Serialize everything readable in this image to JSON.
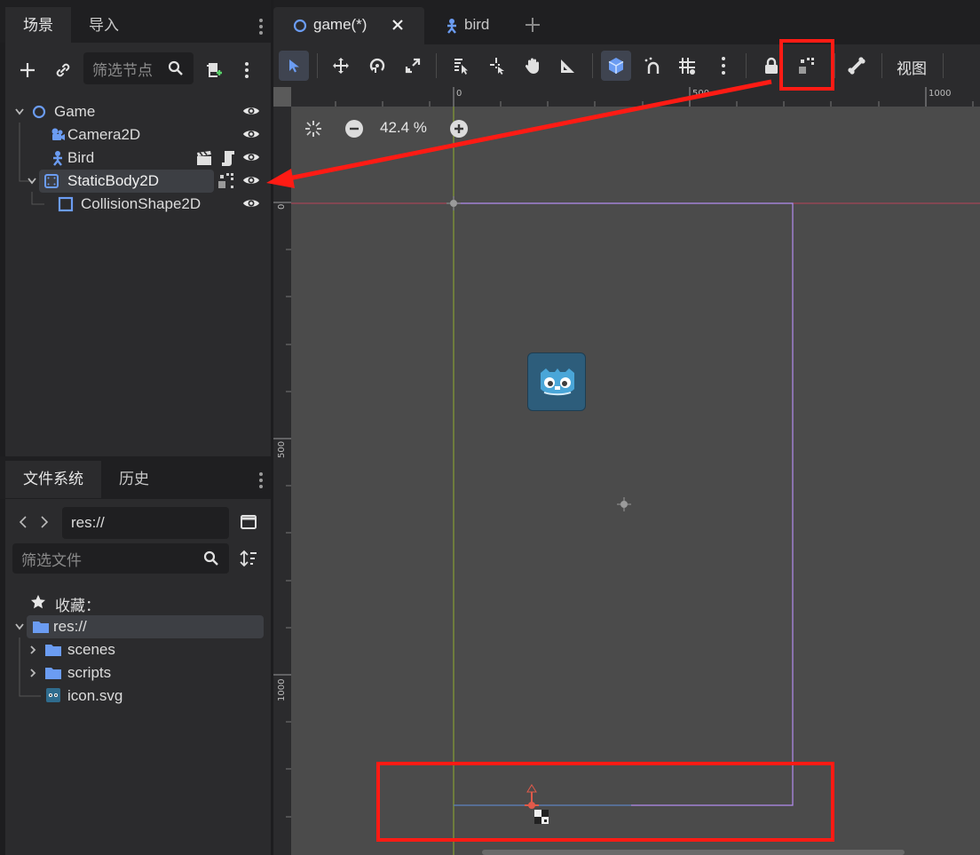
{
  "scene_dock": {
    "tabs": [
      "场景",
      "导入"
    ],
    "filter_placeholder": "筛选节点",
    "nodes": [
      {
        "label": "Game",
        "icon": "node2d-ring-icon"
      },
      {
        "label": "Camera2D",
        "icon": "camera2d-icon"
      },
      {
        "label": "Bird",
        "icon": "characterbody2d-icon"
      },
      {
        "label": "StaticBody2D",
        "icon": "staticbody2d-icon"
      },
      {
        "label": "CollisionShape2D",
        "icon": "collisionshape2d-icon"
      }
    ]
  },
  "filesystem_dock": {
    "tabs": [
      "文件系统",
      "历史"
    ],
    "path": "res://",
    "filter_placeholder": "筛选文件",
    "favorites_label": "收藏：",
    "items": [
      {
        "label": "res://"
      },
      {
        "label": "scenes"
      },
      {
        "label": "scripts"
      },
      {
        "label": "icon.svg"
      }
    ]
  },
  "editor_tabs": [
    {
      "label": "game(*)"
    },
    {
      "label": "bird"
    }
  ],
  "toolbar": {
    "view_menu": "视图"
  },
  "viewport": {
    "zoom": "42.4 %",
    "ruler_h": [
      "0",
      "500",
      "1000"
    ],
    "ruler_v": [
      "0",
      "500",
      "1000"
    ]
  },
  "colors": {
    "accent": "#5b9cf5",
    "annotation_red": "#ff1b14",
    "viewport_bg": "#4b4b4b",
    "frame_purple": "#b48cf0"
  }
}
